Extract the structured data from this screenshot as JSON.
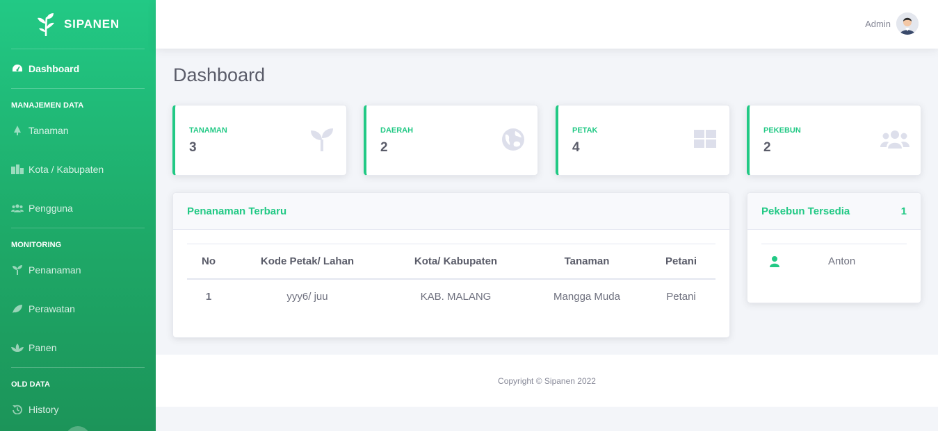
{
  "brand": {
    "name": "SIPANEN",
    "icon": "leaf-sprout-icon"
  },
  "sidebar": {
    "dashboard": "Dashboard",
    "sections": [
      {
        "heading": "MANAJEMEN DATA",
        "items": [
          "Tanaman",
          "Kota / Kabupaten",
          "Pengguna"
        ]
      },
      {
        "heading": "MONITORING",
        "items": [
          "Penanaman",
          "Perawatan",
          "Panen"
        ]
      },
      {
        "heading": "OLD DATA",
        "items": [
          "History"
        ]
      }
    ]
  },
  "topbar": {
    "user_name": "Admin"
  },
  "page": {
    "title": "Dashboard"
  },
  "stats": [
    {
      "label": "TANAMAN",
      "value": "3",
      "icon": "seedling-icon"
    },
    {
      "label": "DAERAH",
      "value": "2",
      "icon": "globe-icon"
    },
    {
      "label": "PETAK",
      "value": "4",
      "icon": "grid-icon"
    },
    {
      "label": "PEKEBUN",
      "value": "2",
      "icon": "users-icon"
    }
  ],
  "planting": {
    "title": "Penanaman Terbaru",
    "columns": [
      "No",
      "Kode Petak/ Lahan",
      "Kota/ Kabupaten",
      "Tanaman",
      "Petani"
    ],
    "rows": [
      [
        "1",
        "yyy6/ juu",
        "KAB. MALANG",
        "Mangga Muda",
        "Petani"
      ]
    ]
  },
  "farmers": {
    "title": "Pekebun Tersedia",
    "count": "1",
    "items": [
      {
        "name": "Anton",
        "icon": "user-icon"
      }
    ]
  },
  "footer": {
    "text": "Copyright © Sipanen 2022"
  },
  "colors": {
    "accent": "#22c985",
    "text": "#5a5c69",
    "muted_icon": "#dddfeb"
  }
}
